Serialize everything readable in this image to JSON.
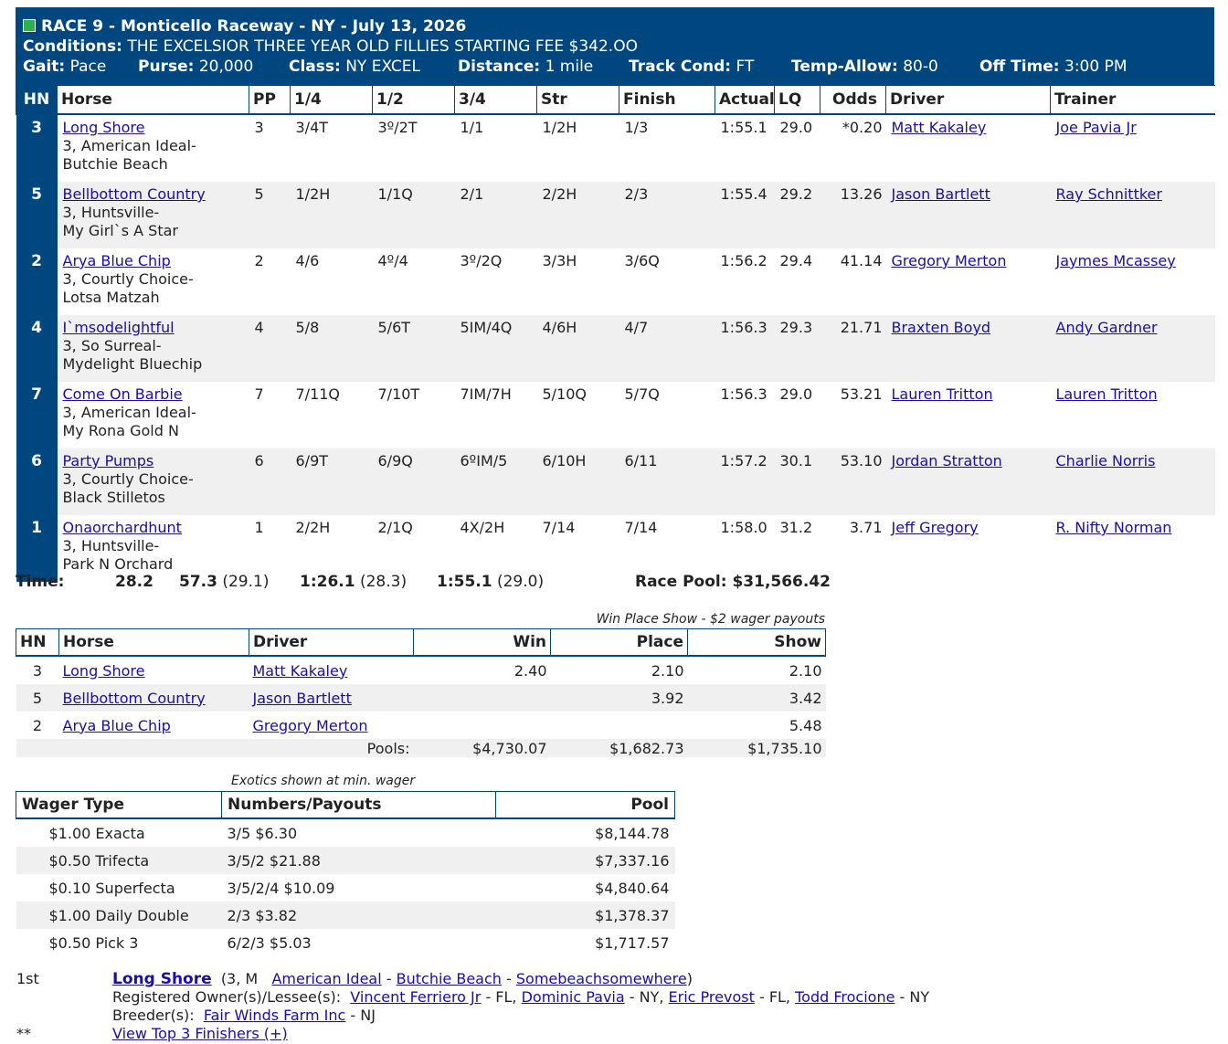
{
  "header": {
    "title": "RACE 9 - Monticello Raceway - NY - July 13, 2026",
    "conditions_label": "Conditions:",
    "conditions": "THE EXCELSIOR THREE YEAR OLD FILLIES STARTING FEE $342.OO",
    "gait_label": "Gait:",
    "gait": "Pace",
    "purse_label": "Purse:",
    "purse": "20,000",
    "class_label": "Class:",
    "class": "NY EXCEL",
    "distance_label": "Distance:",
    "distance": "1 mile",
    "track_label": "Track Cond:",
    "track": "FT",
    "temp_label": "Temp-Allow:",
    "temp": "80-0",
    "off_label": "Off Time:",
    "off": "3:00 PM",
    "accent": "#00467f",
    "status_color": "#2bb24c"
  },
  "results": {
    "columns": [
      "HN",
      "Horse",
      "PP",
      "1/4",
      "1/2",
      "3/4",
      "Str",
      "Finish",
      "Actual",
      "LQ",
      "Odds",
      "Driver",
      "Trainer"
    ],
    "rows": [
      {
        "hn": "3",
        "horse": "Long Shore",
        "age": "3, American Ideal-",
        "dam": "Butchie Beach",
        "pp": "3",
        "q1": "3/4T",
        "q2": "3º/2T",
        "q3": "1/1",
        "str": "1/2H",
        "fin": "1/3",
        "act": "1:55.1",
        "lq": "29.0",
        "odds": "*0.20",
        "driver": "Matt Kakaley",
        "trainer": "Joe Pavia Jr"
      },
      {
        "hn": "5",
        "horse": "Bellbottom Country",
        "age": "3, Huntsville-",
        "dam": "My Girl`s A Star",
        "pp": "5",
        "q1": "1/2H",
        "q2": "1/1Q",
        "q3": "2/1",
        "str": "2/2H",
        "fin": "2/3",
        "act": "1:55.4",
        "lq": "29.2",
        "odds": "13.26",
        "driver": "Jason Bartlett",
        "trainer": "Ray Schnittker"
      },
      {
        "hn": "2",
        "horse": "Arya Blue Chip",
        "age": "3, Courtly Choice-",
        "dam": "Lotsa Matzah",
        "pp": "2",
        "q1": "4/6",
        "q2": "4º/4",
        "q3": "3º/2Q",
        "str": "3/3H",
        "fin": "3/6Q",
        "act": "1:56.2",
        "lq": "29.4",
        "odds": "41.14",
        "driver": "Gregory Merton",
        "trainer": "Jaymes Mcassey"
      },
      {
        "hn": "4",
        "horse": "I`msodelightful",
        "age": "3, So Surreal-",
        "dam": "Mydelight Bluechip",
        "pp": "4",
        "q1": "5/8",
        "q2": "5/6T",
        "q3": "5IM/4Q",
        "str": "4/6H",
        "fin": "4/7",
        "act": "1:56.3",
        "lq": "29.3",
        "odds": "21.71",
        "driver": "Braxten Boyd",
        "trainer": "Andy Gardner"
      },
      {
        "hn": "7",
        "horse": "Come On Barbie",
        "age": "3, American Ideal-",
        "dam": "My Rona Gold N",
        "pp": "7",
        "q1": "7/11Q",
        "q2": "7/10T",
        "q3": "7IM/7H",
        "str": "5/10Q",
        "fin": "5/7Q",
        "act": "1:56.3",
        "lq": "29.0",
        "odds": "53.21",
        "driver": "Lauren Tritton",
        "trainer": "Lauren Tritton"
      },
      {
        "hn": "6",
        "horse": "Party Pumps",
        "age": "3, Courtly Choice-",
        "dam": "Black Stilletos",
        "pp": "6",
        "q1": "6/9T",
        "q2": "6/9Q",
        "q3": "6ºIM/5",
        "str": "6/10H",
        "fin": "6/11",
        "act": "1:57.2",
        "lq": "30.1",
        "odds": "53.10",
        "driver": "Jordan Stratton",
        "trainer": "Charlie Norris"
      },
      {
        "hn": "1",
        "horse": "Onaorchardhunt",
        "age": "3, Huntsville-",
        "dam": "Park N Orchard",
        "pp": "1",
        "q1": "2/2H",
        "q2": "2/1Q",
        "q3": "4X/2H",
        "str": "7/14",
        "fin": "7/14",
        "act": "1:58.0",
        "lq": "31.2",
        "odds": "3.71",
        "driver": "Jeff Gregory",
        "trainer": "R. Nifty Norman"
      }
    ]
  },
  "times": {
    "label": "Time:",
    "t1": "28.2",
    "t2": "57.3",
    "t2s": "(29.1)",
    "t3": "1:26.1",
    "t3s": "(28.3)",
    "t4": "1:55.1",
    "t4s": "(29.0)",
    "pool_label": "Race Pool:",
    "pool": "$31,566.42"
  },
  "wps": {
    "caption": "Win Place Show - $2 wager payouts",
    "columns": [
      "HN",
      "Horse",
      "Driver",
      "Win",
      "Place",
      "Show"
    ],
    "rows": [
      {
        "hn": "3",
        "horse": "Long Shore",
        "driver": "Matt Kakaley",
        "win": "2.40",
        "place": "2.10",
        "show": "2.10"
      },
      {
        "hn": "5",
        "horse": "Bellbottom Country",
        "driver": "Jason Bartlett",
        "win": "",
        "place": "3.92",
        "show": "3.42"
      },
      {
        "hn": "2",
        "horse": "Arya Blue Chip",
        "driver": "Gregory Merton",
        "win": "",
        "place": "",
        "show": "5.48"
      }
    ],
    "pools_label": "Pools:",
    "pool_win": "$4,730.07",
    "pool_place": "$1,682.73",
    "pool_show": "$1,735.10"
  },
  "exotics": {
    "caption": "Exotics shown at min. wager",
    "columns": [
      "Wager Type",
      "Numbers/Payouts",
      "Pool"
    ],
    "rows": [
      {
        "type": "$1.00 Exacta",
        "pay": "3/5 $6.30",
        "pool": "$8,144.78"
      },
      {
        "type": "$0.50 Trifecta",
        "pay": "3/5/2 $21.88",
        "pool": "$7,337.16"
      },
      {
        "type": "$0.10 Superfecta",
        "pay": "3/5/2/4 $10.09",
        "pool": "$4,840.64"
      },
      {
        "type": "$1.00 Daily Double",
        "pay": "2/3 $3.82",
        "pool": "$1,378.37"
      },
      {
        "type": "$0.50 Pick 3",
        "pay": "6/2/3 $5.03",
        "pool": "$1,717.57"
      }
    ]
  },
  "footer": {
    "place": "1st",
    "winner": "Long Shore",
    "winner_info": "(3, M",
    "sire": "American Ideal",
    "dash1": "-",
    "dam": "Butchie Beach",
    "dash2": "-",
    "damsire": "Somebeachsomewhere",
    "close": ")",
    "owners_label": "Registered Owner(s)/Lessee(s):",
    "owners": [
      {
        "name": "Vincent Ferriero Jr",
        "state": "- FL,"
      },
      {
        "name": "Dominic Pavia",
        "state": "- NY,"
      },
      {
        "name": "Eric Prevost",
        "state": "- FL,"
      },
      {
        "name": "Todd Frocione",
        "state": "- NY"
      }
    ],
    "breeder_label": "Breeder(s):",
    "breeder": "Fair Winds Farm Inc",
    "breeder_state": "- NJ",
    "stars": "**",
    "view_top": "View Top 3 Finishers (+)"
  }
}
